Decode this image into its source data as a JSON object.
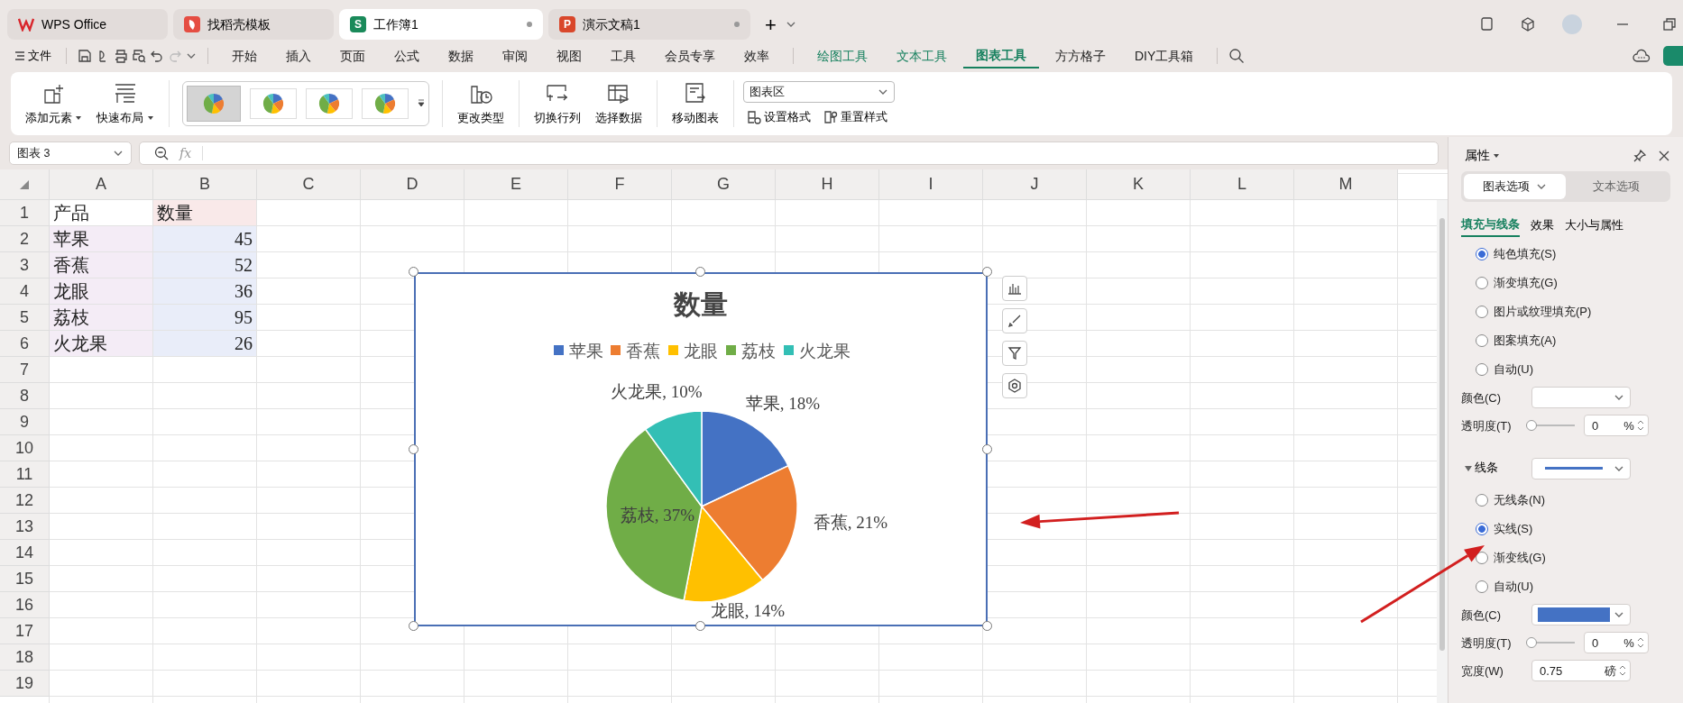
{
  "app_tabs": [
    {
      "kind": "wps",
      "label": "WPS Office",
      "selected": false,
      "unsaved": false
    },
    {
      "kind": "docer",
      "label": "找稻壳模板",
      "selected": false,
      "unsaved": false
    },
    {
      "kind": "sheet",
      "icon_letter": "S",
      "label": "工作簿1",
      "selected": true,
      "unsaved": true
    },
    {
      "kind": "slides",
      "icon_letter": "P",
      "label": "演示文稿1",
      "selected": false,
      "unsaved": true
    }
  ],
  "new_tab": "+",
  "menu": {
    "file": "文件",
    "tabs": [
      {
        "label": "开始",
        "kind": "main",
        "selected": false
      },
      {
        "label": "插入",
        "kind": "main",
        "selected": false
      },
      {
        "label": "页面",
        "kind": "main",
        "selected": false
      },
      {
        "label": "公式",
        "kind": "main",
        "selected": false
      },
      {
        "label": "数据",
        "kind": "main",
        "selected": false
      },
      {
        "label": "审阅",
        "kind": "main",
        "selected": false
      },
      {
        "label": "视图",
        "kind": "main",
        "selected": false
      },
      {
        "label": "工具",
        "kind": "main",
        "selected": false
      },
      {
        "label": "会员专享",
        "kind": "main",
        "selected": false
      },
      {
        "label": "效率",
        "kind": "main",
        "selected": false
      },
      {
        "label": "绘图工具",
        "kind": "context",
        "selected": false
      },
      {
        "label": "文本工具",
        "kind": "context",
        "selected": false
      },
      {
        "label": "图表工具",
        "kind": "context",
        "selected": true
      },
      {
        "label": "方方格子",
        "kind": "main",
        "selected": false
      },
      {
        "label": "DIY工具箱",
        "kind": "main",
        "selected": false
      }
    ]
  },
  "ribbon": [
    {
      "kind": "large",
      "label": "添加元素",
      "dropdown": true
    },
    {
      "kind": "large",
      "label": "快速布局",
      "dropdown": true
    },
    {
      "kind": "gallery",
      "styles": [
        {
          "selected": true
        },
        {
          "selected": false
        },
        {
          "selected": false
        },
        {
          "selected": false
        }
      ]
    },
    {
      "kind": "large",
      "label": "更改类型",
      "dropdown": false
    },
    {
      "kind": "large",
      "label": "切换行列",
      "dropdown": false
    },
    {
      "kind": "large",
      "label": "选择数据",
      "dropdown": false
    },
    {
      "kind": "large",
      "label": "移动图表",
      "dropdown": false
    },
    {
      "kind": "stack",
      "value": "图表区",
      "buttons": [
        "设置格式",
        "重置样式"
      ]
    }
  ],
  "formula_bar": {
    "name_box": "图表 3",
    "fx": "fx"
  },
  "sheet": {
    "columns": [
      "A",
      "B",
      "C",
      "D",
      "E",
      "F",
      "G",
      "H",
      "I",
      "J",
      "K",
      "L",
      "M"
    ],
    "rows": [
      "1",
      "2",
      "3",
      "4",
      "5",
      "6",
      "7",
      "8",
      "9",
      "10",
      "11",
      "12",
      "13",
      "14",
      "15",
      "16",
      "17",
      "18",
      "19"
    ],
    "cells": [
      [
        "产品",
        "数量"
      ],
      [
        "苹果",
        "45"
      ],
      [
        "香蕉",
        "52"
      ],
      [
        "龙眼",
        "36"
      ],
      [
        "荔枝",
        "95"
      ],
      [
        "火龙果",
        "26"
      ]
    ]
  },
  "chart": {
    "chart_data": {
      "type": "pie",
      "title": "数量",
      "categories": [
        "苹果",
        "香蕉",
        "龙眼",
        "荔枝",
        "火龙果"
      ],
      "values": [
        18,
        21,
        14,
        37,
        10
      ],
      "legend": "top",
      "data_labels": true,
      "value_labels": [
        "苹果, 18%",
        "香蕉, 21%",
        "龙眼, 14%",
        "荔枝, 37%",
        "火龙果, 10%"
      ]
    }
  },
  "panel": {
    "title": "属性",
    "tabs": [
      {
        "label": "图表选项",
        "selected": true
      },
      {
        "label": "文本选项",
        "selected": false
      }
    ],
    "subtabs": [
      {
        "label": "填充与线条",
        "selected": true
      },
      {
        "label": "效果",
        "selected": false
      },
      {
        "label": "大小与属性",
        "selected": false
      }
    ],
    "fill_options": [
      {
        "label": "纯色填充(S)",
        "selected": true
      },
      {
        "label": "渐变填充(G)",
        "selected": false
      },
      {
        "label": "图片或纹理填充(P)",
        "selected": false
      },
      {
        "label": "图案填充(A)",
        "selected": false
      },
      {
        "label": "自动(U)",
        "selected": false
      }
    ],
    "fill_color": {
      "label": "颜色(C)",
      "color": "#ffffff"
    },
    "fill_transparency": {
      "label": "透明度(T)",
      "level": 0,
      "value": "0",
      "unit": "%"
    },
    "line_section": {
      "label": "线条",
      "expanded": true,
      "line_style": {
        "color": "#4472c4"
      }
    },
    "line_options": [
      {
        "label": "无线条(N)",
        "selected": false
      },
      {
        "label": "实线(S)",
        "selected": true
      },
      {
        "label": "渐变线(G)",
        "selected": false
      },
      {
        "label": "自动(U)",
        "selected": false
      }
    ],
    "line_color": {
      "label": "颜色(C)",
      "color": "#4472c4"
    },
    "line_transparency": {
      "label": "透明度(T)",
      "level": 0,
      "value": "0",
      "unit": "%"
    },
    "line_width": {
      "label": "宽度(W)",
      "value": "0.75",
      "unit": "磅"
    }
  }
}
